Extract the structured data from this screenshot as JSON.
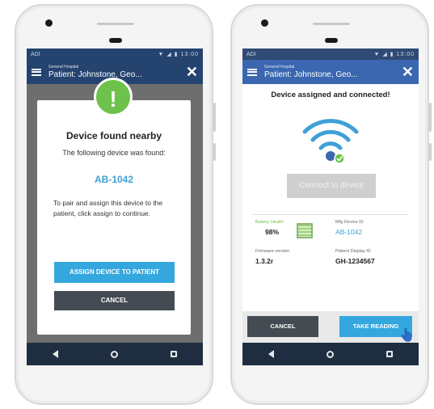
{
  "left_phone": {
    "status_left": "ADI",
    "status_right": "▼ ◢ ▮ 13:00",
    "header_small": "General Hospital",
    "header_title": "Patient: Johnstone, Geo...",
    "dialog": {
      "alert_symbol": "!",
      "title": "Device found nearby",
      "subtitle": "The following device was found:",
      "device_id": "AB-1042",
      "description": "To pair and assign this device to the patient, click assign to continue.",
      "assign_label": "ASSIGN DEVICE TO PATIENT",
      "cancel_label": "CANCEL"
    }
  },
  "right_phone": {
    "status_left": "ADI",
    "status_right": "▼ ◢ ▮ 13:00",
    "header_small": "General Hospital",
    "header_title": "Patient: Johnstone, Geo...",
    "assigned_text": "Device assigned and connected!",
    "connect_label": "Connect to device",
    "battery_label": "Battery Health",
    "battery_value": "98%",
    "mfg_label": "Mfg Device ID",
    "mfg_value": "AB-1042",
    "firmware_label": "Firmware version",
    "firmware_value": "1.3.2r",
    "patient_id_label": "Patient Display ID",
    "patient_id_value": "GH-1234567",
    "cancel_label": "CANCEL",
    "take_reading_label": "TAKE READING"
  },
  "colors": {
    "accent_blue": "#34a8de",
    "app_bar": "#3a67b0",
    "dark_button": "#444b52",
    "success_green": "#6cc24a",
    "mfg_blue": "#3fa0d8"
  },
  "icons": [
    "menu-icon",
    "close-icon",
    "alert-icon",
    "wifi-icon",
    "check-icon",
    "battery-icon",
    "hand-pointer-icon",
    "back-icon",
    "home-icon",
    "recent-apps-icon"
  ]
}
